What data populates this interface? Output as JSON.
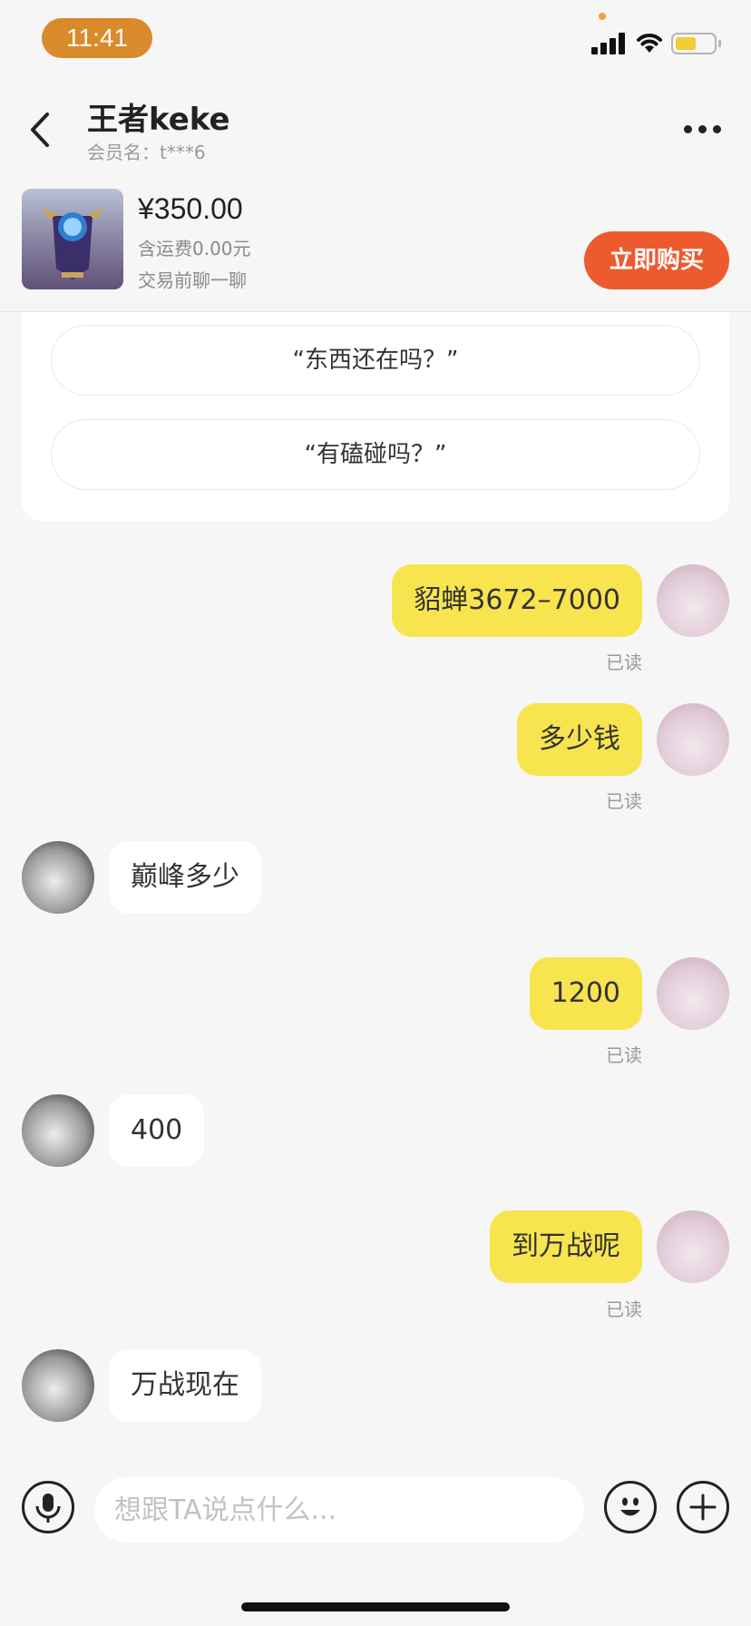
{
  "status_bar": {
    "time": "11:41"
  },
  "header": {
    "title": "王者keke",
    "subtitle": "会员名：t***6"
  },
  "product": {
    "price": "¥350.00",
    "shipping": "含运费0.00元",
    "note": "交易前聊一聊",
    "buy_label": "立即购买"
  },
  "quick_questions": [
    "“东西还在吗？”",
    "“有磕碰吗？”"
  ],
  "messages": [
    {
      "from": "me",
      "text": "貂蝉3672–7000",
      "status": "已读"
    },
    {
      "from": "me",
      "text": "多少钱",
      "status": "已读"
    },
    {
      "from": "other",
      "text": "巅峰多少"
    },
    {
      "from": "me",
      "text": "1200",
      "status": "已读"
    },
    {
      "from": "other",
      "text": "400"
    },
    {
      "from": "me",
      "text": "到万战呢",
      "status": "已读"
    },
    {
      "from": "other",
      "text": "万战现在"
    }
  ],
  "input": {
    "placeholder": "想跟TA说点什么..."
  },
  "icons": {
    "back": "chevron-left-icon",
    "more": "ellipsis-icon",
    "mic": "microphone-icon",
    "emoji": "smiley-icon",
    "plus": "plus-icon"
  },
  "colors": {
    "my_bubble": "#f8e44e",
    "buy_button": "#ec5a2e",
    "time_pill": "#d98a2b"
  }
}
